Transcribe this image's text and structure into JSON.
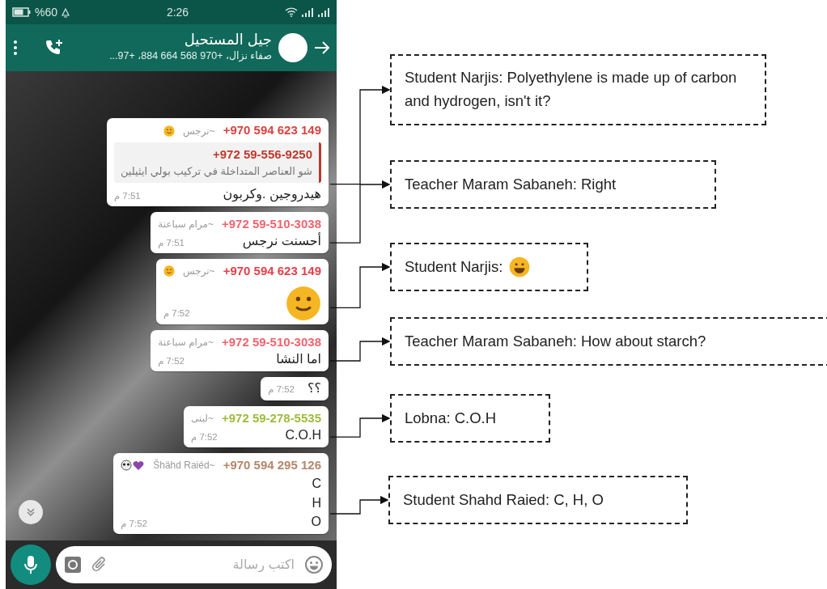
{
  "status_bar": {
    "battery": "%60",
    "time": "2:26"
  },
  "chat_header": {
    "title": "جيل المستحيل",
    "subtitle": "صفاء نزال، +970 568 664 884، +97..."
  },
  "messages": [
    {
      "kind": "quoted",
      "sender_phone": "+970 594 623 149",
      "sender_name": "~نرجس",
      "smiley_after_name": true,
      "color": "#d9423f",
      "quote": {
        "author": "+972 59-556-9250",
        "text": "شو العناصر المتداخلة في تركيب بولي ايثيلين"
      },
      "lines": [
        "هيدروجين .وكربون"
      ],
      "time": "7:51 م"
    },
    {
      "kind": "text",
      "sender_phone": "+972 59-510-3038",
      "sender_name": "~مرام سباعنة",
      "color": "#f0646e",
      "lines": [
        "أحسنت نرجس"
      ],
      "time": "7:51 م"
    },
    {
      "kind": "sticker",
      "sender_phone": "+970 594 623 149",
      "sender_name": "~نرجس",
      "smiley_after_name": true,
      "color": "#e2404a",
      "time": "7:52 م"
    },
    {
      "kind": "text",
      "sender_phone": "+972 59-510-3038",
      "sender_name": "~مرام سباعنة",
      "color": "#f0646e",
      "lines": [
        "اما النشا"
      ],
      "time": "7:52 م"
    },
    {
      "kind": "continued",
      "lines": [
        "؟؟"
      ],
      "time": "7:52 م"
    },
    {
      "kind": "text",
      "sender_phone": "+972 59-278-5535",
      "sender_name": "~لبنى",
      "color": "#9cbc3c",
      "lines": [
        "C.O.H"
      ],
      "time": "7:52 م"
    },
    {
      "kind": "text",
      "sender_phone": "+970 594 295 126",
      "sender_name": "~Šhähd Raiéd",
      "panda_heart_after_name": true,
      "color": "#b5866a",
      "lines": [
        "C",
        "H",
        "O"
      ],
      "time": "7:52 م"
    }
  ],
  "composer": {
    "placeholder": "اكتب رسالة"
  },
  "annotations": [
    {
      "text": "Student Narjis: Polyethylene is made up of carbon and hydrogen, isn't it?",
      "emoji": false
    },
    {
      "text": "Teacher Maram Sabaneh: Right",
      "emoji": false
    },
    {
      "text": "Student Narjis:",
      "emoji": true
    },
    {
      "text": "Teacher Maram Sabaneh: How about starch?",
      "emoji": false
    },
    {
      "text": "Lobna: C.O.H",
      "emoji": false
    },
    {
      "text": "Student Shahd Raied: C, H, O",
      "emoji": false
    }
  ]
}
